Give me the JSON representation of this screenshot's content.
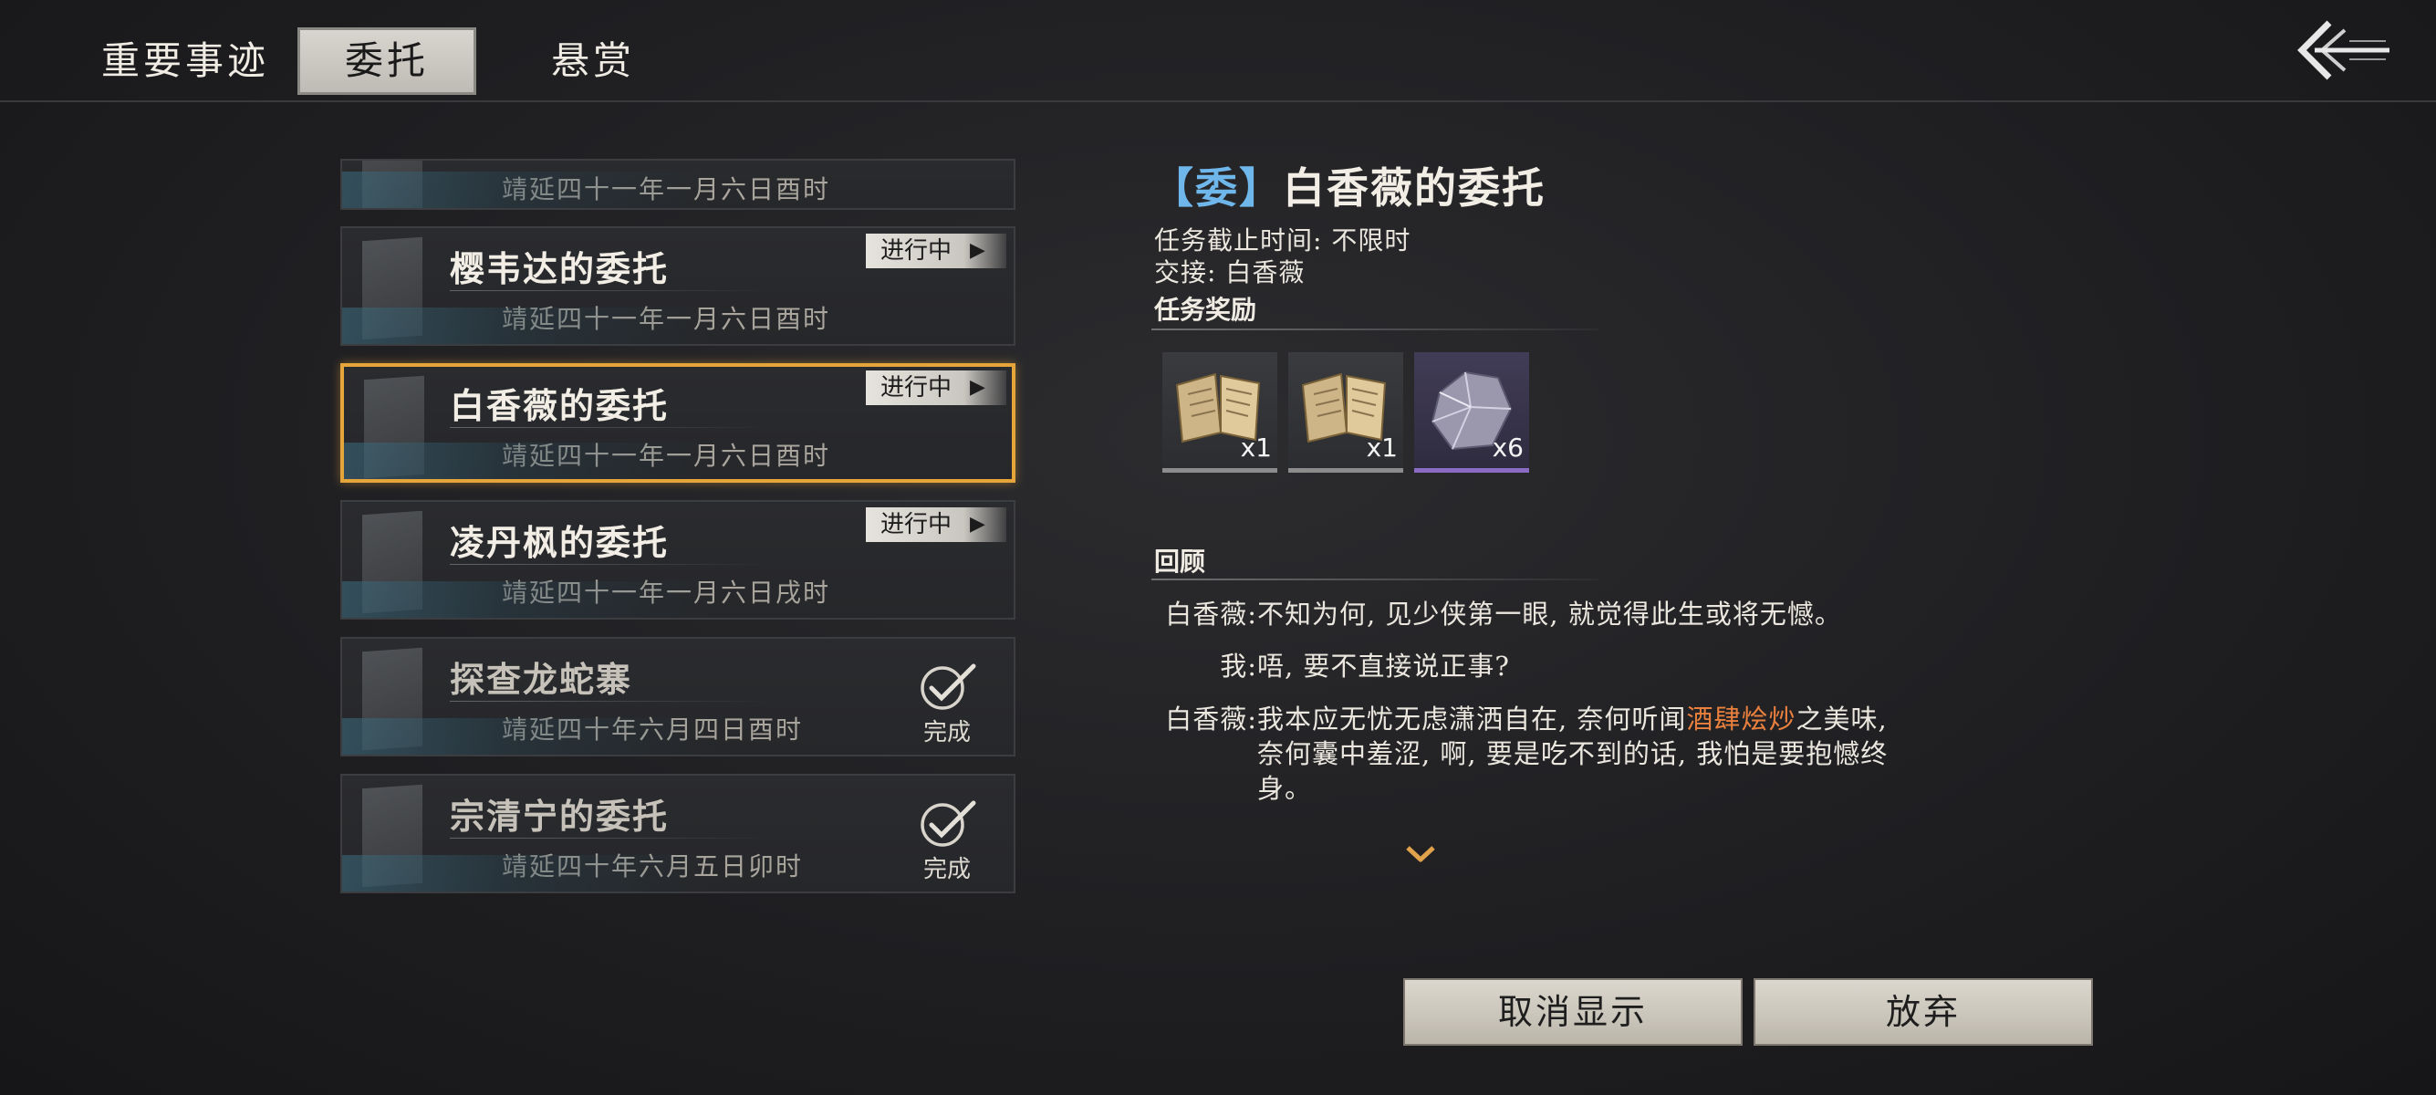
{
  "tabs": [
    {
      "label": "重要事迹",
      "active": false
    },
    {
      "label": "委托",
      "active": true
    },
    {
      "label": "悬赏",
      "active": false
    }
  ],
  "quests": [
    {
      "title": "",
      "date": "靖延四十一年一月六日酉时",
      "status": ""
    },
    {
      "title": "樱韦达的委托",
      "date": "靖延四十一年一月六日酉时",
      "status": "进行中"
    },
    {
      "title": "白香薇的委托",
      "date": "靖延四十一年一月六日酉时",
      "status": "进行中",
      "selected": true
    },
    {
      "title": "凌丹枫的委托",
      "date": "靖延四十一年一月六日戌时",
      "status": "进行中"
    },
    {
      "title": "探查龙蛇寨",
      "date": "靖延四十年六月四日酉时",
      "status": "完成"
    },
    {
      "title": "宗清宁的委托",
      "date": "靖延四十年六月五日卯时",
      "status": "完成"
    }
  ],
  "detail": {
    "tag_open": "【",
    "tag": "委",
    "tag_close": "】",
    "title": "白香薇的委托",
    "deadline": "任务截止时间: 不限时",
    "handover": "交接: 白香薇",
    "rewards_label": "任务奖励",
    "rewards": [
      {
        "icon": "scroll-book-icon",
        "qty": "x1",
        "rarity": "common"
      },
      {
        "icon": "scroll-book-icon",
        "qty": "x1",
        "rarity": "common"
      },
      {
        "icon": "ore-stone-icon",
        "qty": "x6",
        "rarity": "purple"
      }
    ],
    "review_label": "回顾",
    "dialogue": [
      {
        "speaker": "白香薇:",
        "text": "不知为何, 见少侠第一眼, 就觉得此生或将无憾。"
      },
      {
        "speaker": "我:",
        "text": "唔, 要不直接说正事?"
      },
      {
        "speaker": "白香薇:",
        "text_before": "我本应无忧无虑潇洒自在, 奈何听闻",
        "highlight": "酒肆烩炒",
        "text_after": "之美味,",
        "line2": "奈何囊中羞涩, 啊, 要是吃不到的话, 我怕是要抱憾终",
        "line3": "身。"
      }
    ]
  },
  "buttons": {
    "cancel_display": "取消显示",
    "abandon": "放弃"
  },
  "colors": {
    "selected_border": "#e6a53a",
    "tag_blue": "#6fb6ea",
    "highlight": "#e9803e",
    "rare_purple": "#8a6cc4"
  }
}
